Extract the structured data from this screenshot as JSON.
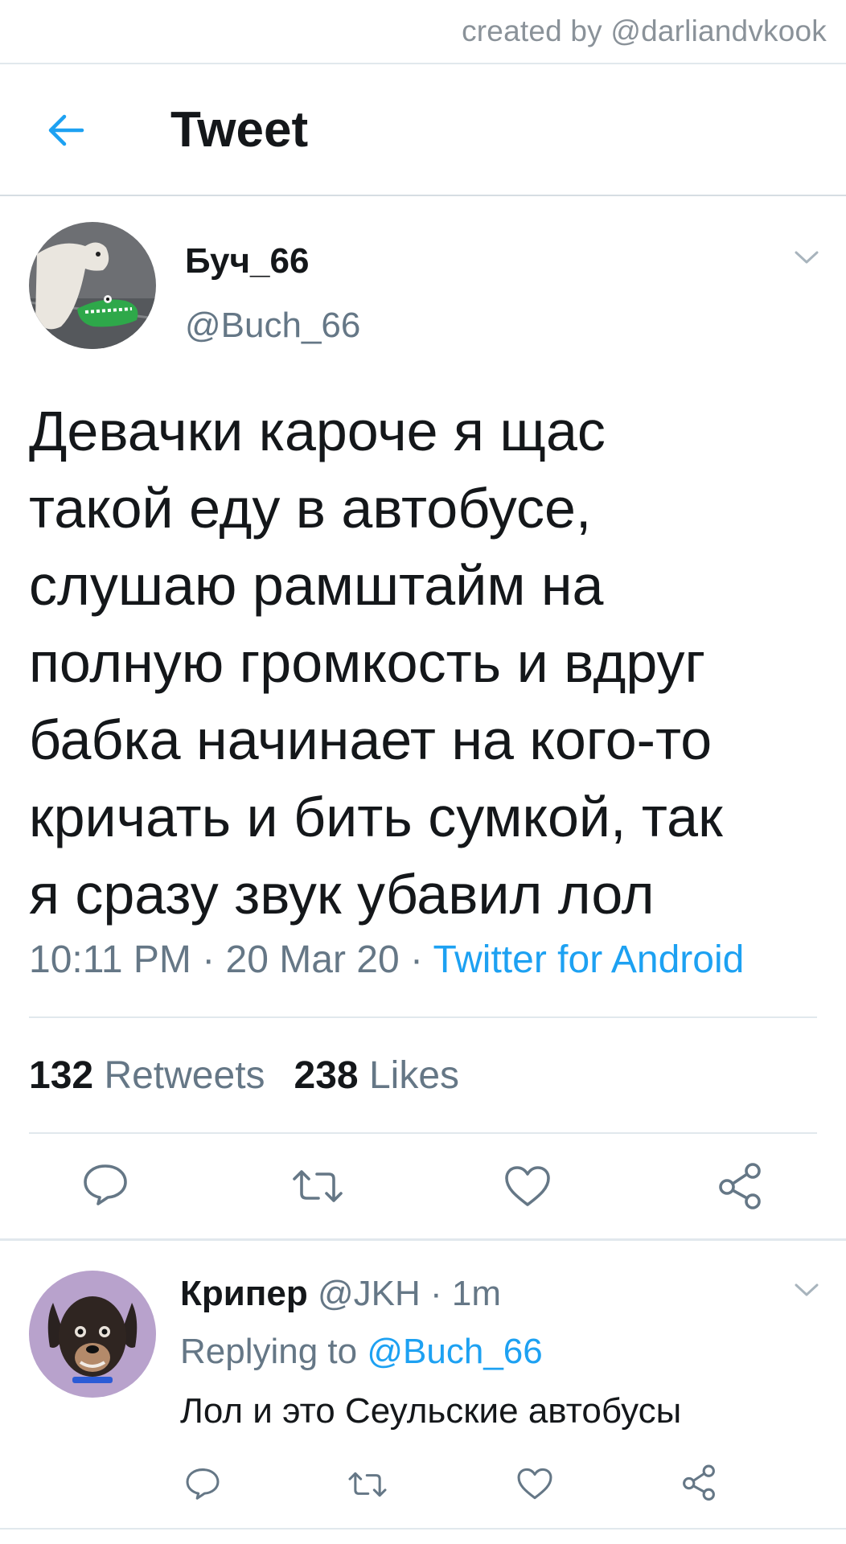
{
  "credit": "created by @darliandvkook",
  "header": {
    "title": "Tweet"
  },
  "tweet": {
    "display_name": "Буч_66",
    "handle": "@Buch_66",
    "text_lines": [
      "Девачки кароче я щас",
      "такой еду в автобусе,",
      "слушаю рамштайм на",
      "полную громкость и вдруг",
      "бабка начинает на кого-то",
      "кричать и бить сумкой, так",
      "я сразу звук убавил лол"
    ],
    "time": "10:11 PM",
    "date": "20 Mar 20",
    "separator": " · ",
    "client": "Twitter for Android",
    "retweets_count": "132",
    "retweets_label": "Retweets",
    "likes_count": "238",
    "likes_label": "Likes"
  },
  "reply": {
    "display_name": "Крипер",
    "handle": "@JKH",
    "age": "1m",
    "replying_prefix": "Replying to ",
    "replying_to": "@Buch_66",
    "text": "Лол и это Сеульские автобусы"
  },
  "icons": {
    "back": "arrow-left-icon",
    "caret": "chevron-down-icon",
    "reply": "reply-bubble-icon",
    "retweet": "retweet-icon",
    "like": "heart-icon",
    "share": "share-icon"
  },
  "colors": {
    "accent": "#1da1f2",
    "text": "#14171a",
    "secondary": "#657786",
    "icon": "#657786"
  }
}
